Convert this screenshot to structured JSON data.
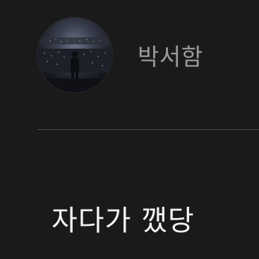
{
  "profile": {
    "username": "박서함",
    "avatar_icon": "profile-photo-concert-stage"
  },
  "post": {
    "text": "자다가 깼당"
  },
  "colors": {
    "background": "#1a1a1a",
    "username": "#9a9a9a",
    "post_text": "#f2f2f2",
    "divider": "#4a4a4a"
  }
}
